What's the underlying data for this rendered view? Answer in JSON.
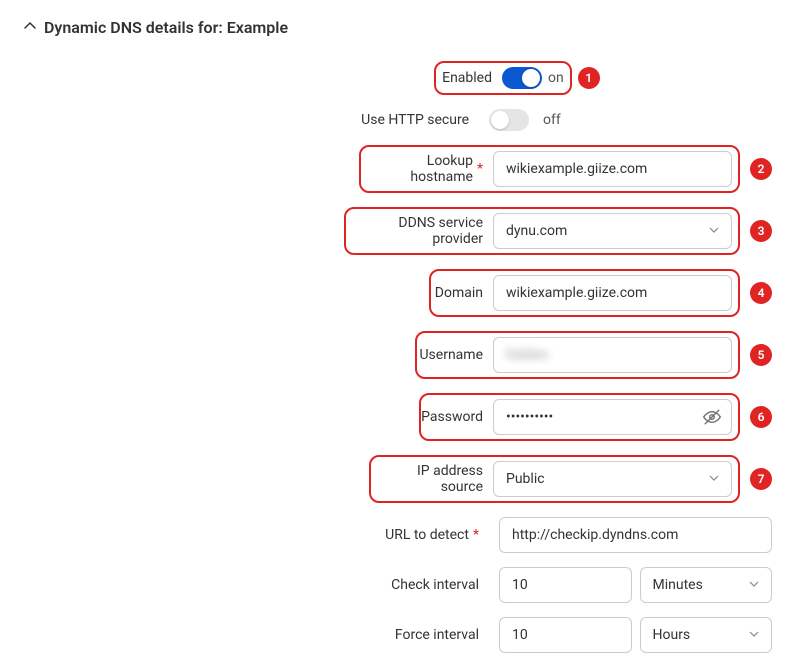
{
  "header": {
    "title": "Dynamic DNS details for: Example"
  },
  "badges": {
    "b1": "1",
    "b2": "2",
    "b3": "3",
    "b4": "4",
    "b5": "5",
    "b6": "6",
    "b7": "7"
  },
  "fields": {
    "enabled": {
      "label": "Enabled",
      "state": "on"
    },
    "httpSecure": {
      "label": "Use HTTP secure",
      "state": "off"
    },
    "lookupHostname": {
      "label": "Lookup hostname",
      "value": "wikiexample.giize.com"
    },
    "provider": {
      "label": "DDNS service provider",
      "value": "dynu.com"
    },
    "domain": {
      "label": "Domain",
      "value": "wikiexample.giize.com"
    },
    "username": {
      "label": "Username",
      "value": "hidden"
    },
    "password": {
      "label": "Password",
      "value": "••••••••••"
    },
    "ipSource": {
      "label": "IP address source",
      "value": "Public"
    },
    "urlDetect": {
      "label": "URL to detect",
      "value": "http://checkip.dyndns.com"
    },
    "checkInterval": {
      "label": "Check interval",
      "value": "10",
      "unit": "Minutes"
    },
    "forceInterval": {
      "label": "Force interval",
      "value": "10",
      "unit": "Hours"
    }
  }
}
